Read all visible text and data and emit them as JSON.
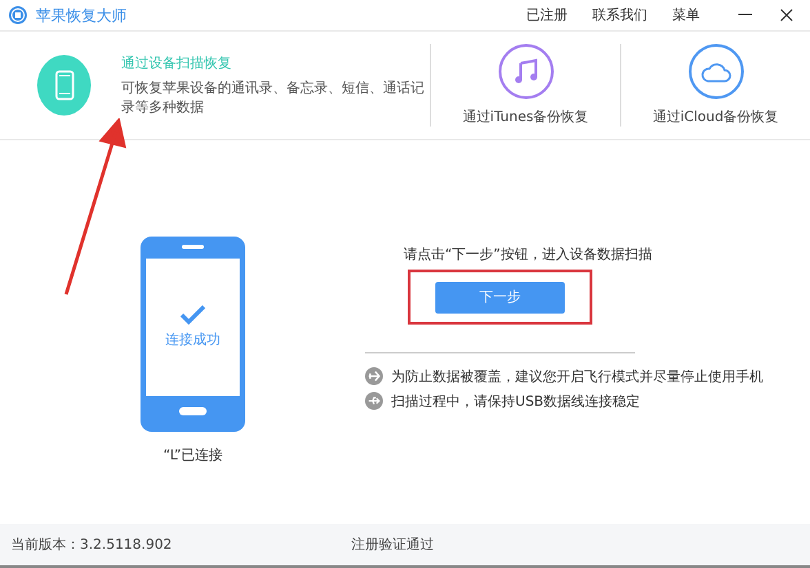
{
  "app_title": "苹果恢复大师",
  "title_links": [
    "已注册",
    "联系我们",
    "菜单"
  ],
  "modes": [
    {
      "kind": "device",
      "title": "通过设备扫描恢复",
      "description": "可恢复苹果设备的通讯录、备忘录、短信、通话记录等多种数据",
      "selected": true,
      "color": "#3fd9c2"
    },
    {
      "kind": "itunes",
      "title": "通过iTunes备份恢复",
      "selected": false,
      "color": "#a47ef0"
    },
    {
      "kind": "icloud",
      "title": "通过iCloud备份恢复",
      "selected": false,
      "color": "#4f98f2"
    }
  ],
  "device": {
    "status": "连接成功",
    "name": "“L”已连接"
  },
  "instruction": "请点击“下一步”按钮，进入设备数据扫描",
  "next_button": "下一步",
  "tips": [
    {
      "kind": "airplane",
      "text": "为防止数据被覆盖，建议您开启飞行模式并尽量停止使用手机"
    },
    {
      "kind": "usb",
      "text": "扫描过程中，请保持USB数据线连接稳定"
    }
  ],
  "footer": {
    "version": "当前版本：3.2.5118.902",
    "status": "注册验证通过"
  }
}
